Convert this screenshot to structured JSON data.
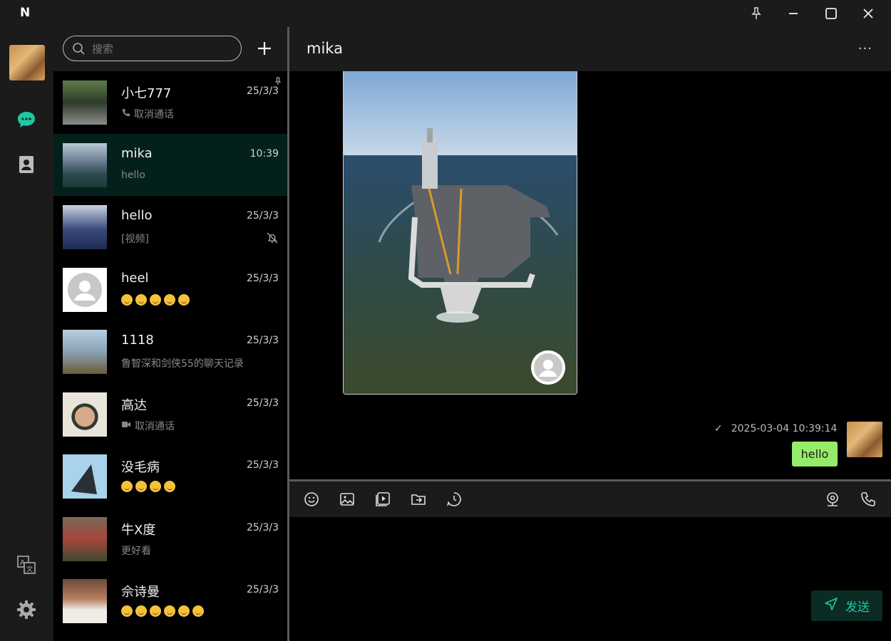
{
  "app": {
    "logo": "N"
  },
  "search": {
    "placeholder": "搜索"
  },
  "conversations": [
    {
      "name": "小七777",
      "time": "25/3/3",
      "preview": "取消通话",
      "preview_icon": "phone-icon",
      "pinned": true
    },
    {
      "name": "mika",
      "time": "10:39",
      "preview": "hello",
      "active": true
    },
    {
      "name": "hello",
      "time": "25/3/3",
      "preview": "[视频]",
      "muted": true
    },
    {
      "name": "heel",
      "time": "25/3/3",
      "preview_emojis": 5
    },
    {
      "name": "1118",
      "time": "25/3/3",
      "preview": "鲁智深和剑侠55的聊天记录"
    },
    {
      "name": "高达",
      "time": "25/3/3",
      "preview": "取消通话",
      "preview_icon": "video-icon"
    },
    {
      "name": "没毛病",
      "time": "25/3/3",
      "preview_emojis": 4
    },
    {
      "name": "牛X度",
      "time": "25/3/3",
      "preview": "更好看"
    },
    {
      "name": "佘诗曼",
      "time": "25/3/3",
      "preview_emojis": 6
    }
  ],
  "chat": {
    "title": "mika",
    "more": "···",
    "messages": [
      {
        "type": "image",
        "description_icon": "aircraft-carrier-photo"
      },
      {
        "type": "text",
        "text": "hello",
        "timestamp": "2025-03-04 10:39:14",
        "status": "✓"
      }
    ]
  },
  "composer": {
    "send_label": "发送"
  },
  "colors": {
    "accent": "#1fc8a0",
    "bubble": "#95ec69",
    "active_row": "#04201a"
  }
}
